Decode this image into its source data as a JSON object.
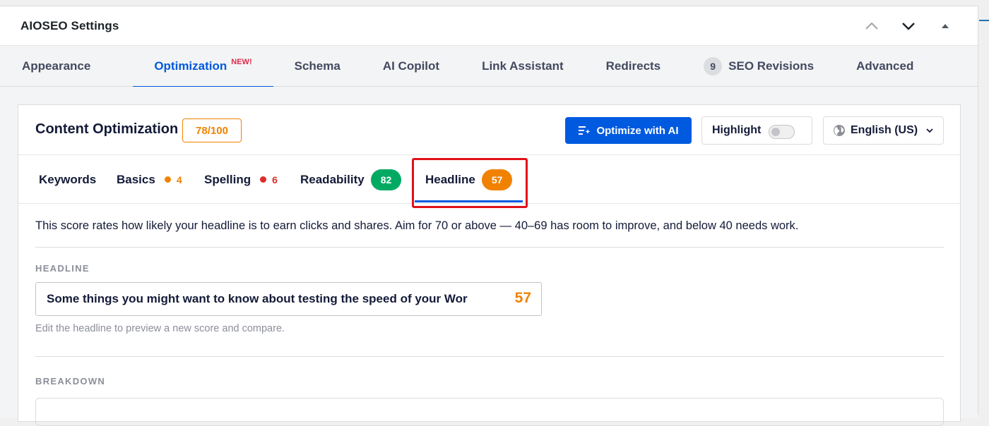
{
  "panel": {
    "title": "AIOSEO Settings",
    "controls": [
      "chevron-up-icon",
      "chevron-down-icon",
      "triangle-up-icon"
    ]
  },
  "tabs": [
    {
      "label": "Appearance"
    },
    {
      "label": "Optimization",
      "badge": "NEW!",
      "active": true
    },
    {
      "label": "Schema"
    },
    {
      "label": "AI Copilot"
    },
    {
      "label": "Link Assistant"
    },
    {
      "label": "Redirects"
    },
    {
      "label": "SEO Revisions",
      "count": "9"
    },
    {
      "label": "Advanced"
    }
  ],
  "content_optimization": {
    "title": "Content Optimization",
    "score": "78/100",
    "optimize_button": "Optimize with AI",
    "highlight_label": "Highlight",
    "highlight_on": false,
    "language": "English (US)"
  },
  "subtabs": {
    "keywords": {
      "label": "Keywords"
    },
    "basics": {
      "label": "Basics",
      "count": "4",
      "color": "#f18200"
    },
    "spelling": {
      "label": "Spelling",
      "count": "6",
      "color": "#df2a2a"
    },
    "readability": {
      "label": "Readability",
      "score": "82",
      "color": "#00aa63"
    },
    "headline": {
      "label": "Headline",
      "score": "57",
      "color": "#f18200",
      "selected": true
    }
  },
  "headline_panel": {
    "description": "This score rates how likely your headline is to earn clicks and shares. Aim for 70 or above — 40–69 has room to improve, and below 40 needs work.",
    "headline_label": "HEADLINE",
    "headline_value": "Some things you might want to know about testing the speed of your Wor",
    "headline_score": "57",
    "hint": "Edit the headline to preview a new score and compare.",
    "breakdown_label": "BREAKDOWN"
  },
  "colors": {
    "accent": "#005ae0",
    "warning": "#f18200",
    "good": "#00aa63",
    "error": "#df2a2a",
    "annotation": "#e1101a"
  }
}
